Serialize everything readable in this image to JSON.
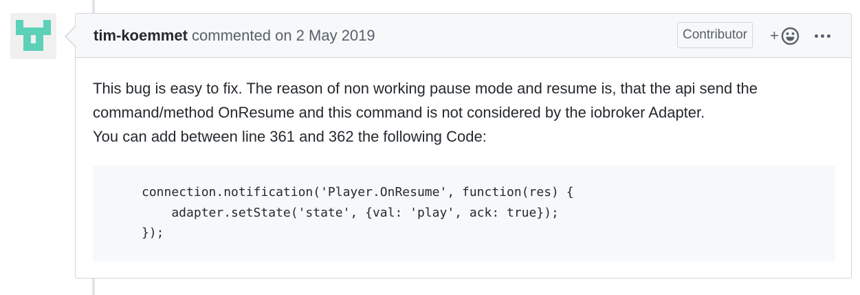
{
  "comment": {
    "author": "tim-koemmet",
    "meta": " commented on 2 May 2019",
    "badge": "Contributor",
    "reaction_plus": "+",
    "body_paragraph_1": "This bug is easy to fix. The reason of non working pause mode and resume is, that the api send the command/method OnResume and this command is not considered by the iobroker Adapter.",
    "body_paragraph_2": "You can add between line 361 and 362 the following Code:",
    "code_lines": [
      "connection.notification('Player.OnResume', function(res) {",
      "    adapter.setState('state', {val: 'play', ack: true});",
      "});"
    ]
  },
  "icons": {
    "reaction": "smiley-icon",
    "more": "kebab-horizontal-icon",
    "avatar": "identicon"
  },
  "colors": {
    "avatar_fill": "#5cd1b8",
    "header_bg": "#f6f8fa",
    "border": "#d1d5da",
    "code_bg": "#f6f8fa"
  }
}
